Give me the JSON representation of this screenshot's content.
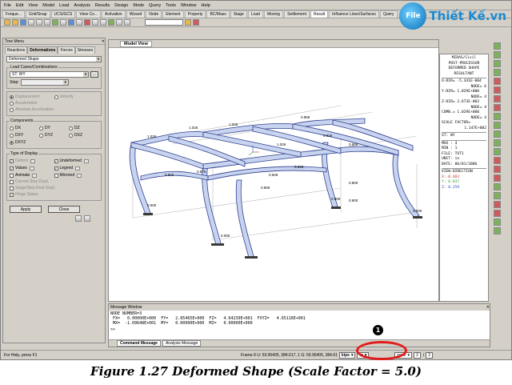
{
  "menu": [
    "File",
    "Edit",
    "View",
    "Model",
    "Load",
    "Analysis",
    "Results",
    "Design",
    "Mode",
    "Query",
    "Tools",
    "Window",
    "Help"
  ],
  "logo": {
    "mark": "File",
    "wordmark": "Thiết Kế.vn"
  },
  "main_tabs": [
    "Freque...",
    "Grid/Snap",
    "UCS/GCS",
    "View Co...",
    "Activation",
    "Wizard",
    "Node",
    "Element",
    "Property",
    "BC/Mass",
    "Stage",
    "Load",
    "Moving",
    "Settlement",
    "Result",
    "Influence Lines/Surfaces",
    "Query"
  ],
  "active_main_tab": "Result",
  "tree_menu": {
    "title": "Tree Menu",
    "tabs": [
      "Reactions",
      "Deformations",
      "Forces",
      "Stresses"
    ],
    "active_tab": "Deformations",
    "result_type": "Deformed Shape",
    "load_cases_label": "Load Cases/Combinations",
    "load_case": "ST: WY",
    "step_label": "Step:",
    "step_value": "",
    "options": [
      "Displacement",
      "Velocity",
      "Acceleration",
      "Absolute Acceleration"
    ],
    "components_label": "Components",
    "components": [
      "DX",
      "DY",
      "DZ",
      "DXY",
      "DYZ",
      "DXZ",
      "DXYZ"
    ],
    "selected_component": "DXYZ",
    "display_label": "Type of Display",
    "display_options": [
      {
        "label": "Deform",
        "checked": true,
        "dim": true
      },
      {
        "label": "Undeformed",
        "checked": true,
        "dim": false
      },
      {
        "label": "Values",
        "checked": true,
        "dim": false
      },
      {
        "label": "Legend",
        "checked": true,
        "dim": false
      },
      {
        "label": "Animate",
        "checked": false,
        "dim": false
      },
      {
        "label": "Mirrored",
        "checked": false,
        "dim": false
      }
    ],
    "extra_options": [
      "Current Step Displ.",
      "Stage/Step Real Displ.",
      "Hinge Status"
    ],
    "apply_label": "Apply",
    "close_label": "Close"
  },
  "model_view_tab": "Model View",
  "node_labels": [
    "1.026",
    "0.859",
    "1.026",
    "0.928",
    "1.026",
    "0.859",
    "1.026",
    "0.928",
    "0.929",
    "0.875",
    "0.859",
    "0.800",
    "0.800",
    "0.900",
    "0.000",
    "0.000",
    "0.000",
    "0.000"
  ],
  "info_panel": {
    "lines": [
      "MIDAS/Civil",
      "POST-PROCESSOR",
      "DEFORMED SHAPE",
      "RESULTANT",
      "X-DIR= -5.341E-004",
      "NODE= 6",
      "Y-DIR= 1.029E+000",
      "NODE= 4",
      "Z-DIR= 2.673E-003",
      "NODE= 4",
      "COMB.= 1.029E+000",
      "NODE= 4",
      "SCALE FACTOR=",
      "1.147E+002",
      "ST: WY",
      "MAX : 4",
      "MIN : 1",
      "FILE: TUT1",
      "UNIT: in",
      "DATE: 06/01/2006",
      "VIEW-DIRECTION",
      "X:-0.483",
      "Y: 0.837",
      "Z: 0.259"
    ]
  },
  "message_window": {
    "title": "Message Window",
    "lines": [
      "NODE NUMBER=3",
      " FX=   0.00000E+000  FY=   2.85465E+000  FZ=   4.64239E+001  FXYZ=   4.65116E+001",
      " MX=  -1.09648E+001  MY=   0.00000E+000  MZ=   0.00000E+000"
    ],
    "prompt": ">>",
    "tabs": [
      "Command Message",
      "Analysis Message"
    ],
    "active_tab": "Command Message"
  },
  "status_bar": {
    "help": "For Help, press F1",
    "frame": "Frame-9 U: 59.95405, 384.617, 1  G: 59.95405, 384.61",
    "force_unit": "kips",
    "length_unit": "in",
    "extra": "none",
    "page_current": "2",
    "page_total": "2"
  },
  "marker_number": "1",
  "caption": "Figure 1.27  Deformed Shape (Scale Factor = 5.0)"
}
